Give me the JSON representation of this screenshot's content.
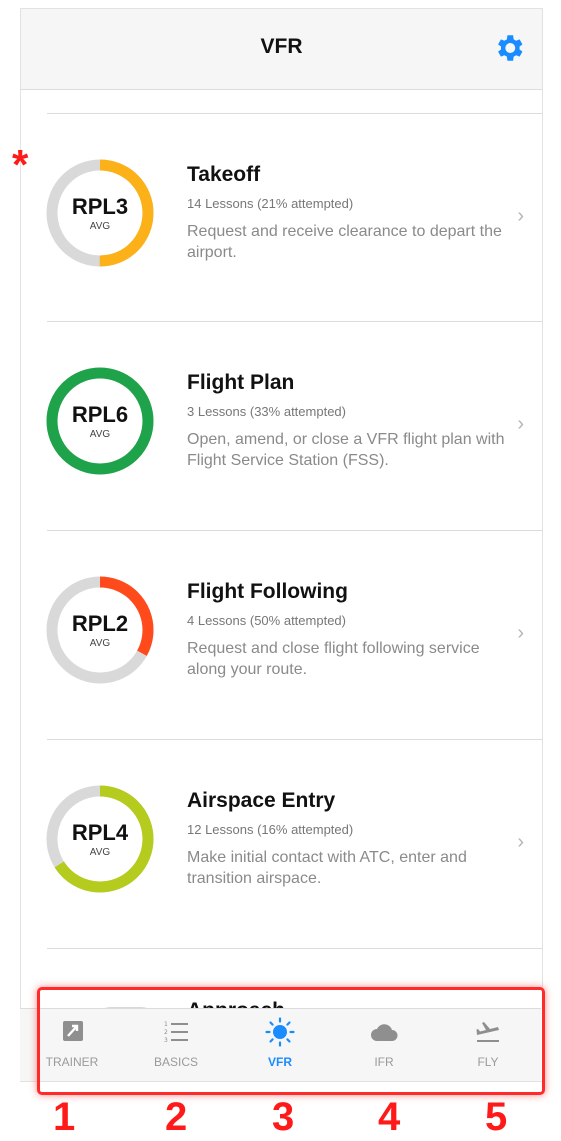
{
  "navbar": {
    "title": "VFR"
  },
  "icons": {
    "settings": "gear-icon",
    "chevron": "chevron-right-icon"
  },
  "annotation": {
    "asterisk": "*"
  },
  "lessons": [
    {
      "level": "RPL3",
      "level_sub": "AVG",
      "title": "Takeoff",
      "meta": "14 Lessons (21% attempted)",
      "desc": "Request and receive clearance to depart the airport.",
      "progress": 0.5,
      "color": "#fbb117"
    },
    {
      "level": "RPL6",
      "level_sub": "AVG",
      "title": "Flight Plan",
      "meta": "3 Lessons (33% attempted)",
      "desc": "Open, amend, or close a VFR flight plan with Flight Service Station (FSS).",
      "progress": 1.0,
      "color": "#1fa34a"
    },
    {
      "level": "RPL2",
      "level_sub": "AVG",
      "title": "Flight Following",
      "meta": "4 Lessons (50% attempted)",
      "desc": "Request and close flight following service along your route.",
      "progress": 0.33,
      "color": "#ff4a1c"
    },
    {
      "level": "RPL4",
      "level_sub": "AVG",
      "title": "Airspace Entry",
      "meta": "12 Lessons (16% attempted)",
      "desc": "Make initial contact with ATC, enter and transition airspace.",
      "progress": 0.66,
      "color": "#b5cc1e"
    }
  ],
  "peek": {
    "title": "Approach"
  },
  "tabs": [
    {
      "label": "TRAINER",
      "icon": "trainer-icon",
      "active": false
    },
    {
      "label": "BASICS",
      "icon": "numbered-list-icon",
      "active": false
    },
    {
      "label": "VFR",
      "icon": "sun-icon",
      "active": true
    },
    {
      "label": "IFR",
      "icon": "cloud-icon",
      "active": false
    },
    {
      "label": "FLY",
      "icon": "airplane-takeoff-icon",
      "active": false
    }
  ],
  "callouts": [
    "1",
    "2",
    "3",
    "4",
    "5"
  ],
  "colors": {
    "accent": "#1a8cff",
    "highlight": "#ff2a2a",
    "ring_track": "#d9d9d9"
  }
}
